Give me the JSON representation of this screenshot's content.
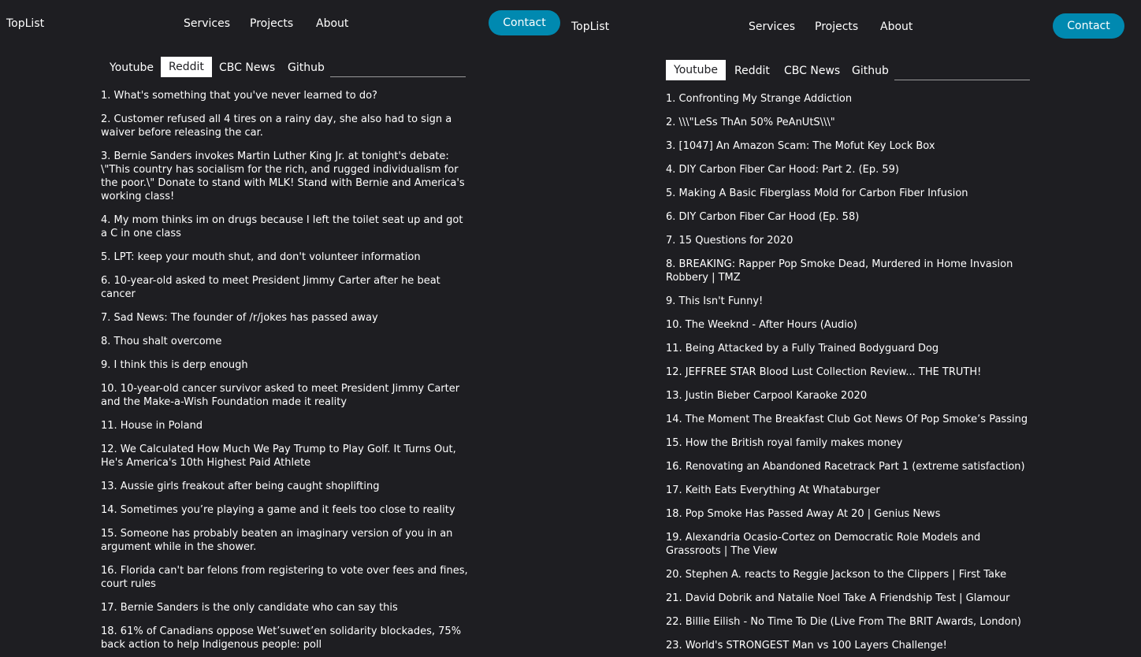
{
  "left": {
    "brand": "TopList",
    "nav": {
      "services": "Services",
      "projects": "Projects",
      "about": "About",
      "contact": "Contact"
    },
    "tabs": [
      "Youtube",
      "Reddit",
      "CBC News",
      "Github"
    ],
    "active_tab": "Reddit",
    "items": [
      "1. What's something that you've never learned to do?",
      "2. Customer refused all 4 tires on a rainy day, she also had to sign a waiver before releasing the car.",
      "3. Bernie Sanders invokes Martin Luther King Jr. at tonight's debate: \\\"This country has socialism for the rich, and rugged individualism for the poor.\\\" Donate to stand with MLK! Stand with Bernie and America's working class!",
      "4. My mom thinks im on drugs because I left the toilet seat up and got a C in one class",
      "5. LPT: keep your mouth shut, and don't volunteer information",
      "6. 10-year-old asked to meet President Jimmy Carter after he beat cancer",
      "7. Sad News: The founder of /r/jokes has passed away",
      "8. Thou shalt overcome",
      "9. I think this is derp enough",
      "10. 10-year-old cancer survivor asked to meet President Jimmy Carter and the Make-a-Wish Foundation made it reality",
      "11. House in Poland",
      "12. We Calculated How Much We Pay Trump to Play Golf. It Turns Out, He's America's 10th Highest Paid Athlete",
      "13. Aussie girls freakout after being caught shoplifting",
      "14. Sometimes you’re playing a game and it feels too close to reality",
      "15. Someone has probably beaten an imaginary version of you in an argument while in the shower.",
      "16. Florida can't bar felons from registering to vote over fees and fines, court rules",
      "17. Bernie Sanders is the only candidate who can say this",
      "18. 61% of Canadians oppose Wet’suwet’en solidarity blockades, 75% back action to help Indigenous people: poll"
    ]
  },
  "right": {
    "brand": "TopList",
    "nav": {
      "services": "Services",
      "projects": "Projects",
      "about": "About",
      "contact": "Contact"
    },
    "tabs": [
      "Youtube",
      "Reddit",
      "CBC News",
      "Github"
    ],
    "active_tab": "Youtube",
    "items": [
      "1. Confronting My Strange Addiction",
      "2. \\\\\\\"LeSs ThAn 50% PeAnUtS\\\\\\\"",
      "3. [1047] An Amazon Scam: The Mofut Key Lock Box",
      "4. DIY Carbon Fiber Car Hood: Part 2. (Ep. 59)",
      "5. Making A Basic Fiberglass Mold for Carbon Fiber Infusion",
      "6. DIY Carbon Fiber Car Hood (Ep. 58)",
      "7. 15 Questions for 2020",
      "8. BREAKING: Rapper Pop Smoke Dead, Murdered in Home Invasion Robbery | TMZ",
      "9. This Isn't Funny!",
      "10. The Weeknd - After Hours (Audio)",
      "11. Being Attacked by a Fully Trained Bodyguard Dog",
      "12. JEFFREE STAR Blood Lust Collection Review... THE TRUTH!",
      "13. Justin Bieber Carpool Karaoke 2020",
      "14. The Moment The Breakfast Club Got News Of Pop Smoke’s Passing",
      "15. How the British royal family makes money",
      "16. Renovating an Abandoned Racetrack Part 1 (extreme satisfaction)",
      "17. Keith Eats Everything At Whataburger",
      "18. Pop Smoke Has Passed Away At 20 | Genius News",
      "19. Alexandria Ocasio-Cortez on Democratic Role Models and Grassroots | The View",
      "20. Stephen A. reacts to Reggie Jackson to the Clippers | First Take",
      "21. David Dobrik and Natalie Noel Take A Friendship Test | Glamour",
      "22. Billie Eilish - No Time To Die (Live From The BRIT Awards, London)",
      "23. World's STRONGEST Man vs 100 Layers Challenge!"
    ]
  },
  "colors": {
    "background": "#1e1e22",
    "text": "#ffffff",
    "accent": "#0089b0",
    "active_tab_bg": "#ffffff",
    "active_tab_text": "#1e1e22"
  }
}
